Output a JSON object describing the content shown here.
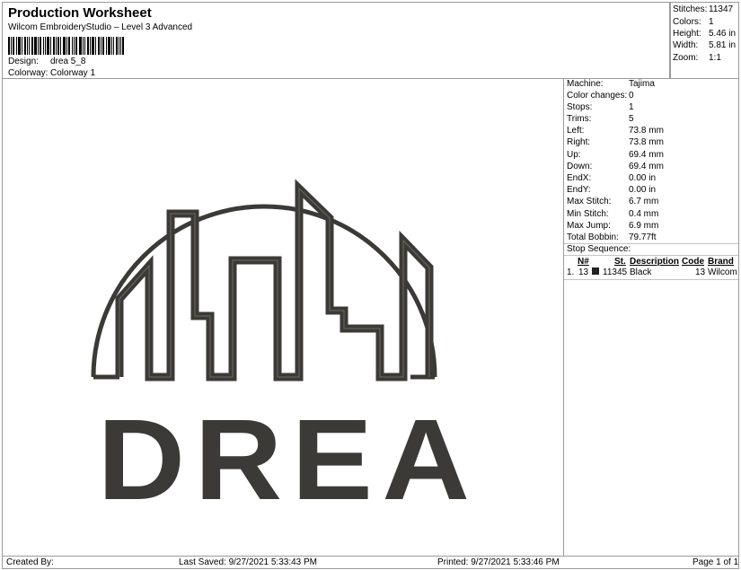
{
  "header": {
    "title": "Production Worksheet",
    "subtitle": "Wilcom EmbroideryStudio – Level 3 Advanced",
    "design_label": "Design:",
    "design_value": "drea 5_8",
    "colorway_label": "Colorway:",
    "colorway_value": "Colorway 1"
  },
  "summary": [
    {
      "label": "Stitches:",
      "value": "11347"
    },
    {
      "label": "Colors:",
      "value": "1"
    },
    {
      "label": "Height:",
      "value": "5.46 in"
    },
    {
      "label": "Width:",
      "value": "5.81 in"
    },
    {
      "label": "Zoom:",
      "value": "1:1"
    }
  ],
  "details": [
    {
      "label": "Machine:",
      "value": "Tajima"
    },
    {
      "label": "Color changes:",
      "value": "0"
    },
    {
      "label": "Stops:",
      "value": "1"
    },
    {
      "label": "Trims:",
      "value": "5"
    },
    {
      "label": "Left:",
      "value": "73.8 mm"
    },
    {
      "label": "Right:",
      "value": "73.8 mm"
    },
    {
      "label": "Up:",
      "value": "69.4 mm"
    },
    {
      "label": "Down:",
      "value": "69.4 mm"
    },
    {
      "label": "EndX:",
      "value": "0.00 in"
    },
    {
      "label": "EndY:",
      "value": "0.00 in"
    },
    {
      "label": "Max Stitch:",
      "value": "6.7 mm"
    },
    {
      "label": "Min Stitch:",
      "value": "0.4 mm"
    },
    {
      "label": "Max Jump:",
      "value": "6.9 mm"
    },
    {
      "label": "Total Bobbin:",
      "value": "79.77ft"
    }
  ],
  "stop_sequence": {
    "title": "Stop Sequence:",
    "headers": {
      "n": "N#",
      "st": "St.",
      "description": "Description",
      "code": "Code",
      "brand": "Brand"
    },
    "rows": [
      {
        "index": "1.",
        "n": "13",
        "st": "11345",
        "description": "Black",
        "code": "13",
        "brand": "Wilcom",
        "color": "#222222"
      }
    ]
  },
  "design": {
    "text": "DREA",
    "thread_color": "#3b3a36"
  },
  "footer": {
    "created_by": "Created By:",
    "last_saved": "Last Saved: 9/27/2021 5:33:43 PM",
    "printed": "Printed: 9/27/2021 5:33:46 PM",
    "page": "Page 1 of 1"
  }
}
